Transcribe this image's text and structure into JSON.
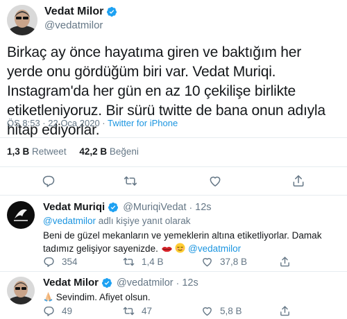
{
  "main_tweet": {
    "author": {
      "name": "Vedat Milor",
      "handle": "@vedatmilor",
      "verified": true
    },
    "text": "Birkaç ay önce hayatıma giren ve baktığım her yerde onu gördüğüm biri var. Vedat Muriqi. Instagram'da her gün en az 10 çekilişe birlikte etiketleniyoruz. Bir sürü twitte de bana onun adıyla hitap ediyorlar.",
    "time": "ÖS 8:53 · 22 Oca 2020 · ",
    "source": "Twitter for iPhone",
    "retweets_count": "1,3 B",
    "retweets_label": "Retweet",
    "likes_count": "42,2 B",
    "likes_label": "Beğeni"
  },
  "replies": [
    {
      "author": {
        "name": "Vedat Muriqi",
        "handle": "@MuriqiVedat",
        "time": "12s",
        "verified": true
      },
      "reply_to_mention": "@vedatmilor",
      "reply_to_suffix": " adlı kişiye yanıt olarak",
      "text": "Beni de güzel mekanların ve yemeklerin altına etiketliyorlar. Damak tadımız gelişiyor sayenizde.",
      "text_mention": "@vedatmilor",
      "reply_count": "354",
      "retweet_count": "1,4 B",
      "like_count": "37,8 B"
    },
    {
      "author": {
        "name": "Vedat Milor",
        "handle": "@vedatmilor",
        "time": "12s",
        "verified": true
      },
      "text": "Sevindim. Afiyet olsun.",
      "reply_count": "49",
      "retweet_count": "47",
      "like_count": "5,8 B"
    }
  ],
  "icons": {
    "verified": "verified-badge-icon",
    "reply": "speech-bubble-icon",
    "retweet": "retweet-arrows-icon",
    "like": "heart-icon",
    "share": "share-upload-icon"
  },
  "colors": {
    "text": "#14171a",
    "muted": "#657786",
    "link": "#1b95e0",
    "verified": "#1da1f2",
    "divider": "#e6ecf0"
  }
}
